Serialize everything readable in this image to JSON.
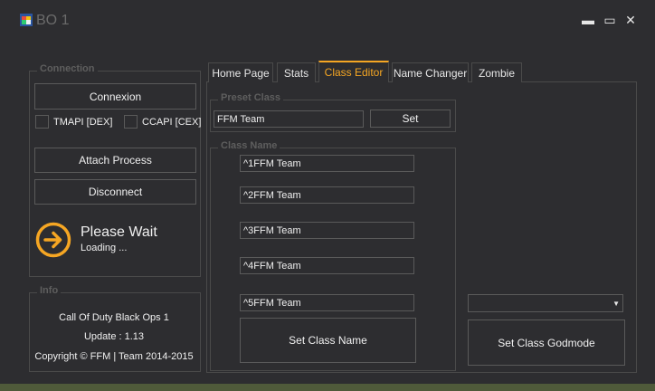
{
  "window": {
    "title": "BO 1",
    "minimize": "▬",
    "maximize": "▭",
    "close": "✕"
  },
  "connection": {
    "group_title": "Connection",
    "connexion_label": "Connexion",
    "tmapi_label": "TMAPI [DEX]",
    "ccapi_label": "CCAPI [CEX]",
    "attach_label": "Attach Process",
    "disconnect_label": "Disconnect",
    "status_title": "Please Wait",
    "status_sub": "Loading ..."
  },
  "info": {
    "group_title": "Info",
    "game": "Call Of Duty Black Ops 1",
    "update": "Update : 1.13",
    "copyright": "Copyright © FFM | Team 2014-2015"
  },
  "tabs": [
    {
      "label": "Home Page"
    },
    {
      "label": "Stats"
    },
    {
      "label": "Class Editor"
    },
    {
      "label": "Name Changer"
    },
    {
      "label": "Zombie"
    }
  ],
  "preset": {
    "group_title": "Preset Class",
    "value": "FFM Team",
    "set_label": "Set"
  },
  "class_name": {
    "group_title": "Class Name",
    "fields": [
      "^1FFM Team",
      "^2FFM Team",
      "^3FFM Team",
      "^4FFM Team",
      "^5FFM Team"
    ],
    "set_label": "Set Class Name"
  },
  "godmode": {
    "dropdown_value": "",
    "set_label": "Set Class Godmode"
  },
  "colors": {
    "accent": "#f5a623",
    "background": "#2d2d30",
    "border": "#5a5a5a"
  },
  "icons": {
    "status_icon": "arrow-right-circle-icon",
    "app_icon": "app-window-icon",
    "dropdown_icon": "chevron-down-icon"
  }
}
